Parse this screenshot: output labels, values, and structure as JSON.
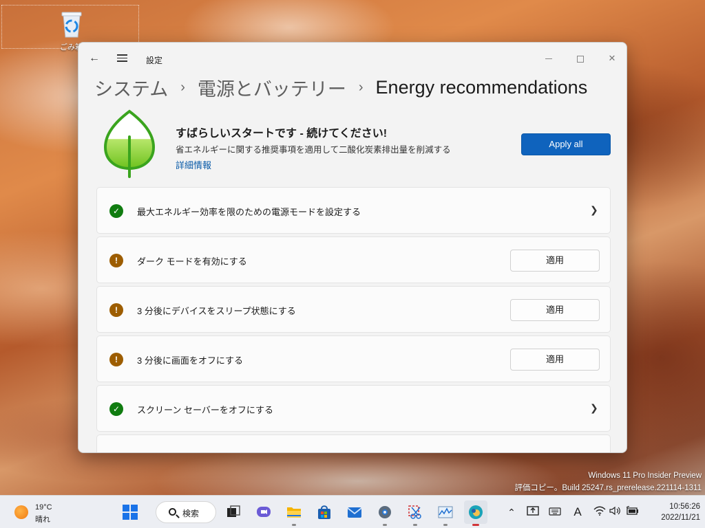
{
  "desktop": {
    "recycle_bin_label": "ごみ箱"
  },
  "window": {
    "title": "設定",
    "breadcrumb": {
      "level1": "システム",
      "level2": "電源とバッテリー",
      "current": "Energy recommendations"
    },
    "hero": {
      "title": "すばらしいスタートです - 続けてください!",
      "subtitle": "省エネルギーに関する推奨事項を適用して二酸化炭素排出量を削減する",
      "link": "詳細情報",
      "apply_all_label": "Apply all",
      "accent_color": "#0f63bd",
      "leaf_color": "#3aa41e"
    },
    "recommendations": [
      {
        "label": "最大エネルギー効率を限のための電源モードを設定する",
        "status": "applied",
        "action": "chevron"
      },
      {
        "label": "ダーク モードを有効にする",
        "status": "pending",
        "action": "適用"
      },
      {
        "label": "3 分後にデバイスをスリープ状態にする",
        "status": "pending",
        "action": "適用"
      },
      {
        "label": "3 分後に画面をオフにする",
        "status": "pending",
        "action": "適用"
      },
      {
        "label": "スクリーン セーバーをオフにする",
        "status": "applied",
        "action": "chevron"
      }
    ],
    "status_colors": {
      "applied": "#107c10",
      "pending": "#9d5d00"
    }
  },
  "watermark": {
    "line1": "Windows 11 Pro Insider Preview",
    "line2": "評価コピー。Build 25247.rs_prerelease.221114-1311"
  },
  "taskbar": {
    "weather": {
      "temp": "19°C",
      "condition": "晴れ"
    },
    "search_label": "検索",
    "apps": [
      "start-icon",
      "task-view-icon",
      "chat-icon",
      "file-explorer-icon",
      "store-icon",
      "mail-icon",
      "settings-icon",
      "snipping-tool-icon",
      "performance-monitor-icon",
      "edge-icon"
    ],
    "tray_icons": [
      "chevron-up-icon",
      "upload-icon",
      "keyboard-icon",
      "ime-icon",
      "wifi-icon",
      "volume-icon",
      "battery-icon"
    ],
    "ime_label": "A",
    "time": "10:56:26",
    "date": "2022/11/21"
  }
}
